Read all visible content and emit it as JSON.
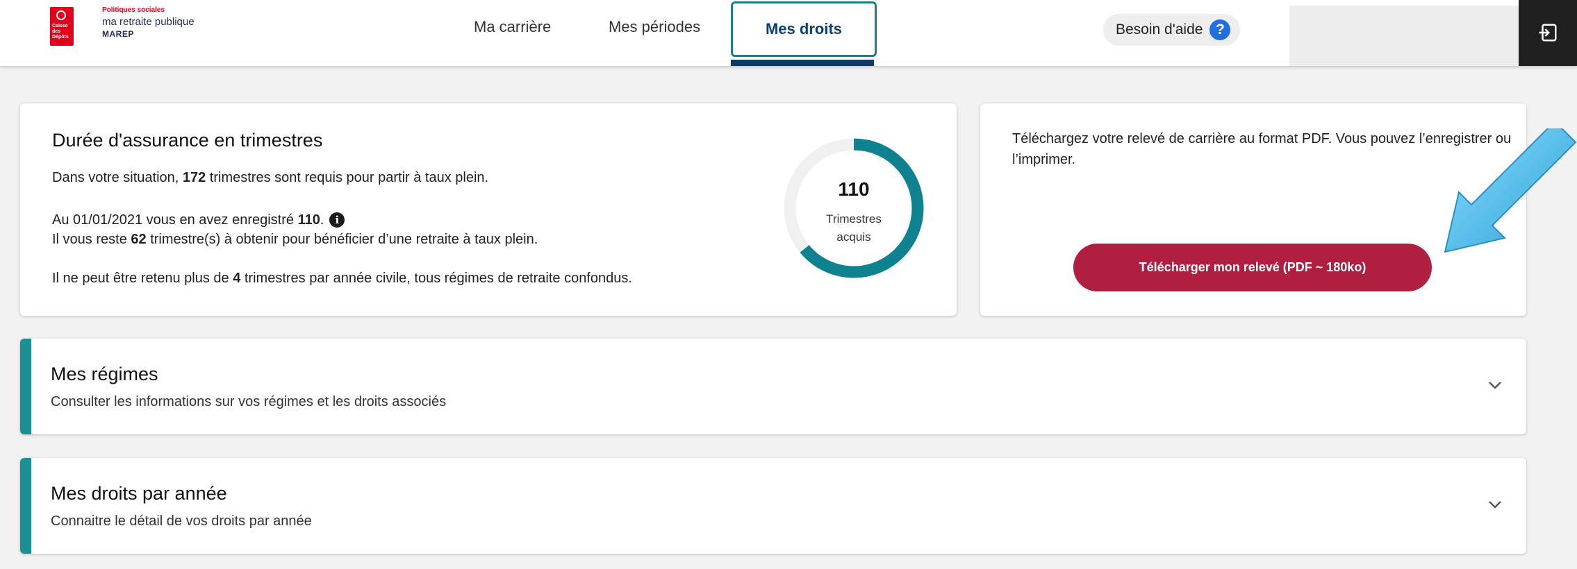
{
  "header": {
    "logo_text": "Caisse des Dépôts",
    "brand_small": "Politiques sociales",
    "brand_main": "ma retraite publique",
    "brand_sub": "MAREP",
    "nav": [
      "Ma carrière",
      "Mes périodes",
      "Mes droits"
    ],
    "active_tab": "Mes droits",
    "help_label": "Besoin d'aide",
    "help_icon": "question-circle-icon",
    "logout_icon": "logout-icon"
  },
  "insurance_card": {
    "title": "Durée d'assurance en trimestres",
    "line1_pre": "Dans votre situation, ",
    "line1_num": "172",
    "line1_post": " trimestres sont requis pour partir à taux plein.",
    "line2_pre": "Au 01/01/2021 vous en avez enregistré ",
    "line2_num": "110",
    "line2_post": ".",
    "line3_pre": "Il vous reste ",
    "line3_num": "62",
    "line3_post": " trimestre(s) à obtenir pour bénéficier d’une retraite à taux plein.",
    "line4_pre": "Il ne peut être retenu plus de ",
    "line4_num": "4",
    "line4_post": " trimestres par année civile, tous régimes de retraite confondus.",
    "donut_value": "110",
    "donut_label_1": "Trimestres",
    "donut_label_2": "acquis",
    "donut_fraction": 0.64,
    "donut_color": "#0f8290"
  },
  "download_card": {
    "text": "Téléchargez votre relevé de carrière au format PDF. Vous pouvez l’enregistrer ou l’imprimer.",
    "button": "Télécharger mon relevé (PDF ~ 180ko)",
    "button_color": "#b01f3f"
  },
  "accordions": [
    {
      "title": "Mes régimes",
      "subtitle": "Consulter les informations sur vos régimes et les droits associés"
    },
    {
      "title": "Mes droits par année",
      "subtitle": "Connaitre le détail de vos droits par année"
    }
  ],
  "colors": {
    "accent": "#1a8f94",
    "nav_active": "#0b3f73",
    "arrow": "#3fb6e6"
  }
}
